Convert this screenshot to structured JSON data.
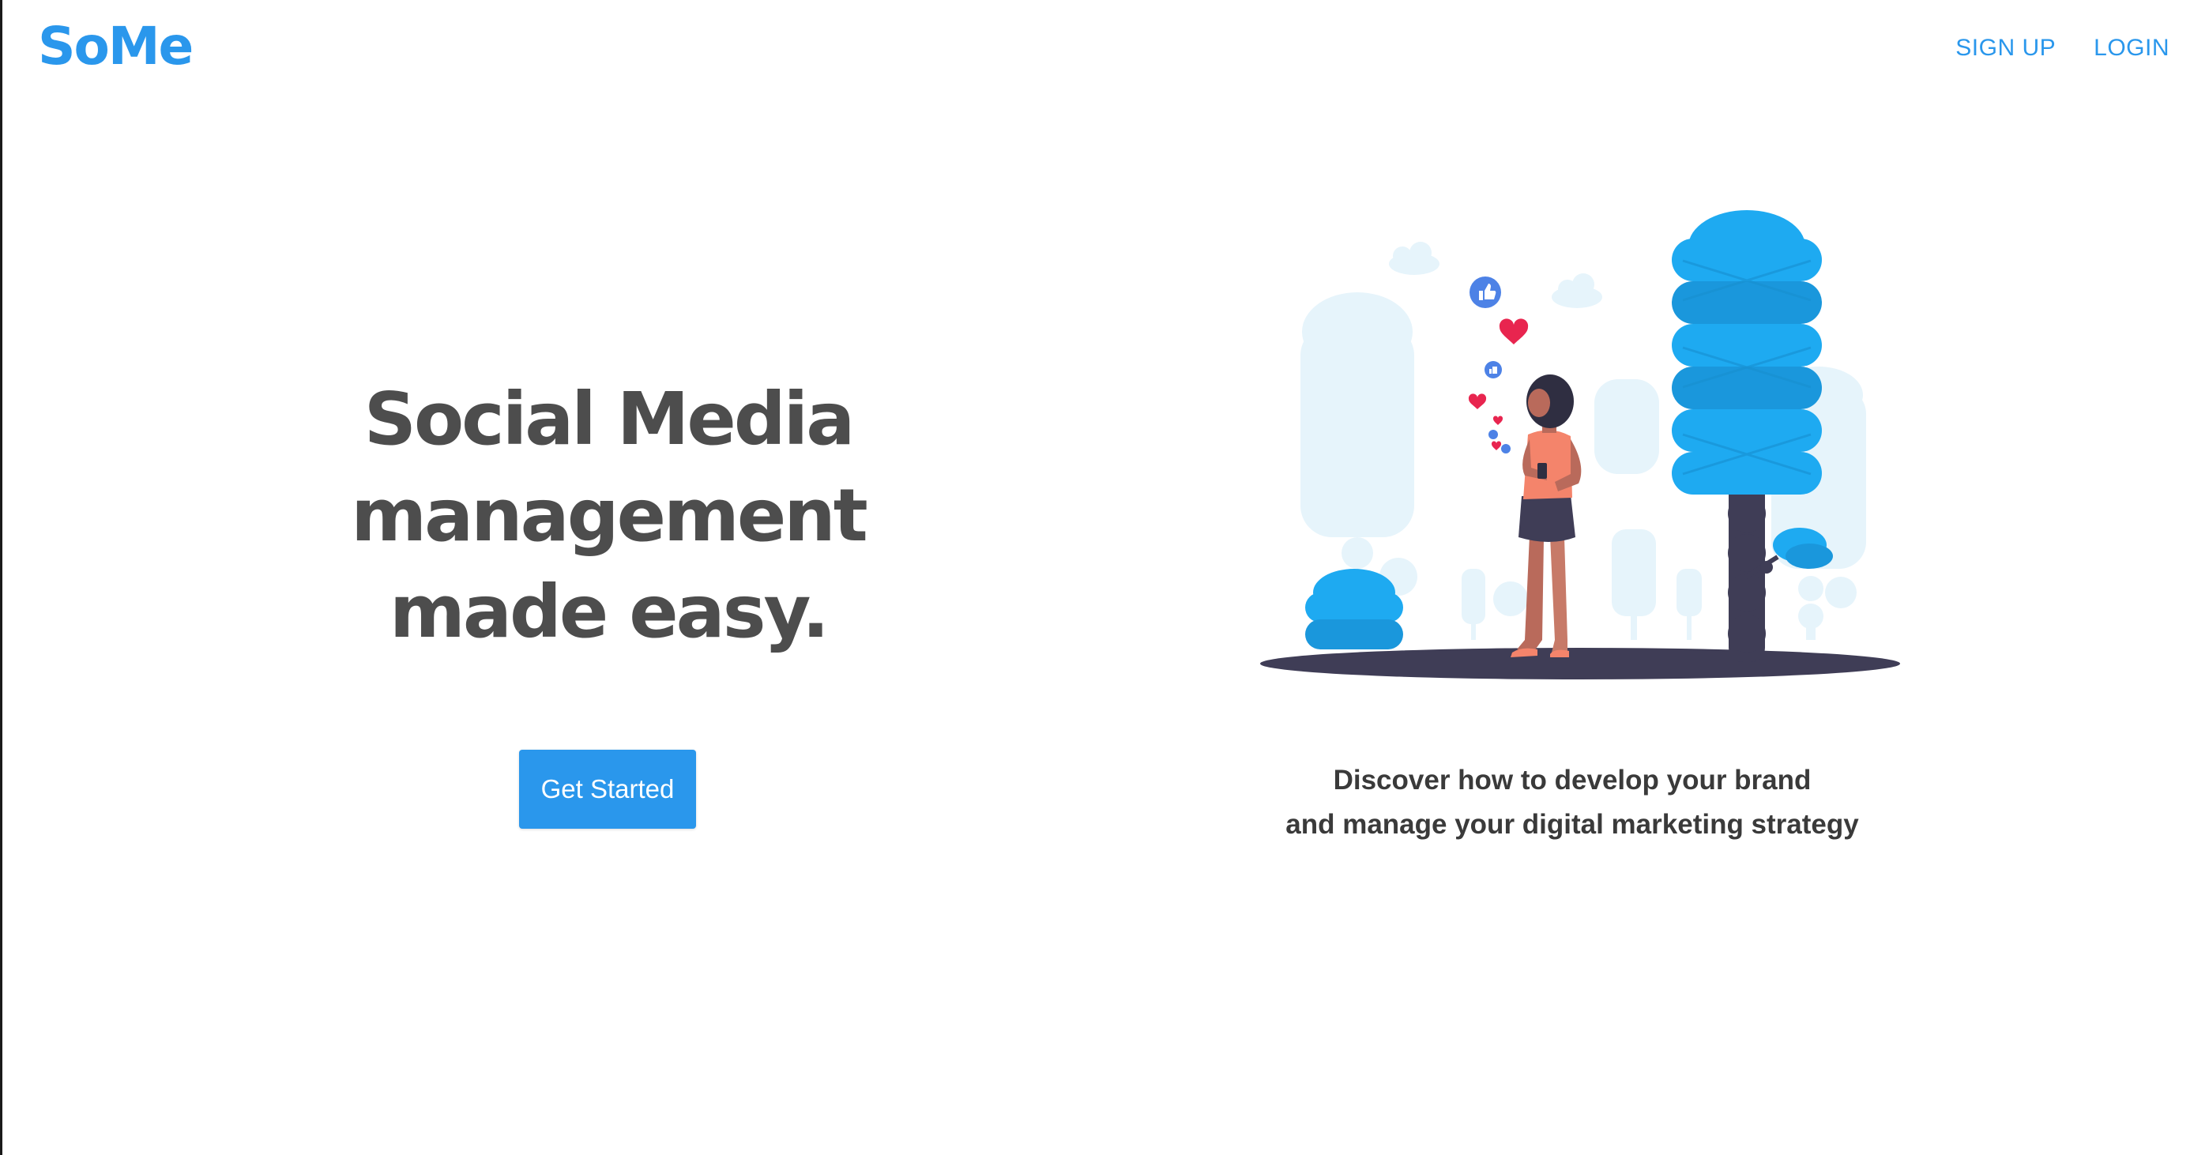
{
  "header": {
    "logo": "SoMe",
    "nav": {
      "signup_label": "SIGN UP",
      "login_label": "LOGIN"
    }
  },
  "hero": {
    "headline_lines": [
      "Social Media",
      "management",
      "made easy."
    ],
    "cta_label": "Get Started",
    "tagline_lines": [
      "Discover how to develop your brand",
      "and manage your digital marketing strategy"
    ]
  },
  "illustration": {
    "subject": "woman looking at phone with likes and hearts among stylized trees",
    "icons": [
      "thumbs-up-icon",
      "heart-icon"
    ]
  },
  "colors": {
    "brand": "#2a97ec",
    "headline": "#4d4d4d",
    "tree_blue": "#1eaaf1",
    "tree_dark_blue": "#1a97dc",
    "tree_pale": "#e6f4fb",
    "ground": "#3f3d56",
    "shirt": "#f4846b",
    "heart": "#e8254f",
    "like": "#4d82e6"
  }
}
